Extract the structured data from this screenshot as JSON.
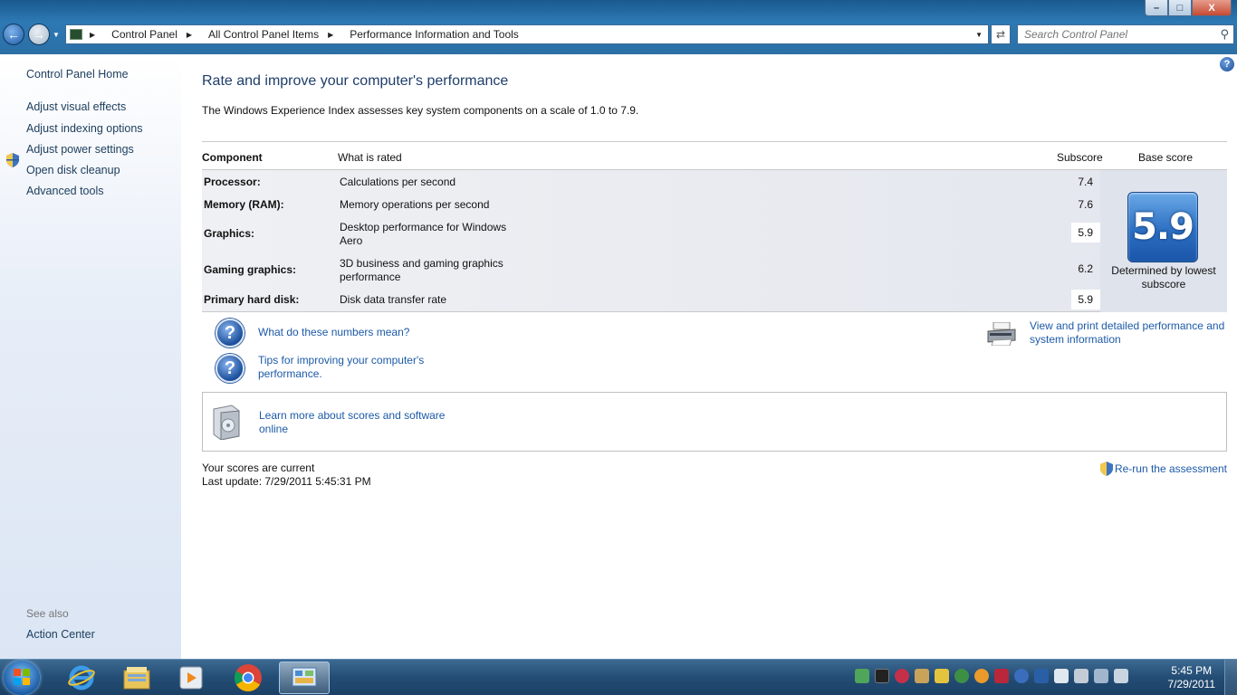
{
  "window": {
    "breadcrumbs": [
      "Control Panel",
      "All Control Panel Items",
      "Performance Information and Tools"
    ],
    "search_placeholder": "Search Control Panel",
    "caption_buttons": {
      "minimize": "–",
      "maximize": "□",
      "close": "X"
    }
  },
  "sidebar": {
    "home": "Control Panel Home",
    "tasks": [
      "Adjust visual effects",
      "Adjust indexing options",
      "Adjust power settings",
      "Open disk cleanup",
      "Advanced tools"
    ],
    "see_also_label": "See also",
    "see_also_items": [
      "Action Center"
    ]
  },
  "main": {
    "title": "Rate and improve your computer's performance",
    "description": "The Windows Experience Index assesses key system components on a scale of 1.0 to 7.9.",
    "table": {
      "headers": {
        "component": "Component",
        "what": "What is rated",
        "subscore": "Subscore",
        "base": "Base score"
      },
      "rows": [
        {
          "component": "Processor:",
          "what": "Calculations per second",
          "subscore": "7.4"
        },
        {
          "component": "Memory (RAM):",
          "what": "Memory operations per second",
          "subscore": "7.6"
        },
        {
          "component": "Graphics:",
          "what": "Desktop performance for Windows Aero",
          "subscore": "5.9"
        },
        {
          "component": "Gaming graphics:",
          "what": "3D business and gaming graphics performance",
          "subscore": "6.2"
        },
        {
          "component": "Primary hard disk:",
          "what": "Disk data transfer rate",
          "subscore": "5.9"
        }
      ],
      "base_score": "5.9",
      "base_note": "Determined by lowest subscore"
    },
    "links": {
      "numbers_meaning": "What do these numbers mean?",
      "tips": "Tips for improving your computer's performance.",
      "view_print": "View and print detailed performance and system information",
      "learn_more": "Learn more about scores and software online",
      "rerun": "Re-run the assessment"
    },
    "status": {
      "current": "Your scores are current",
      "last_update": "Last update: 7/29/2011 5:45:31 PM"
    }
  },
  "taskbar": {
    "apps": [
      "internet-explorer-icon",
      "windows-explorer-icon",
      "media-player-icon",
      "chrome-icon",
      "control-panel-icon"
    ],
    "clock_time": "5:45 PM",
    "clock_date": "7/29/2011"
  },
  "colors": {
    "link": "#1c5aa8",
    "title": "#1e3d6a",
    "badge": "#2d6fc3"
  }
}
